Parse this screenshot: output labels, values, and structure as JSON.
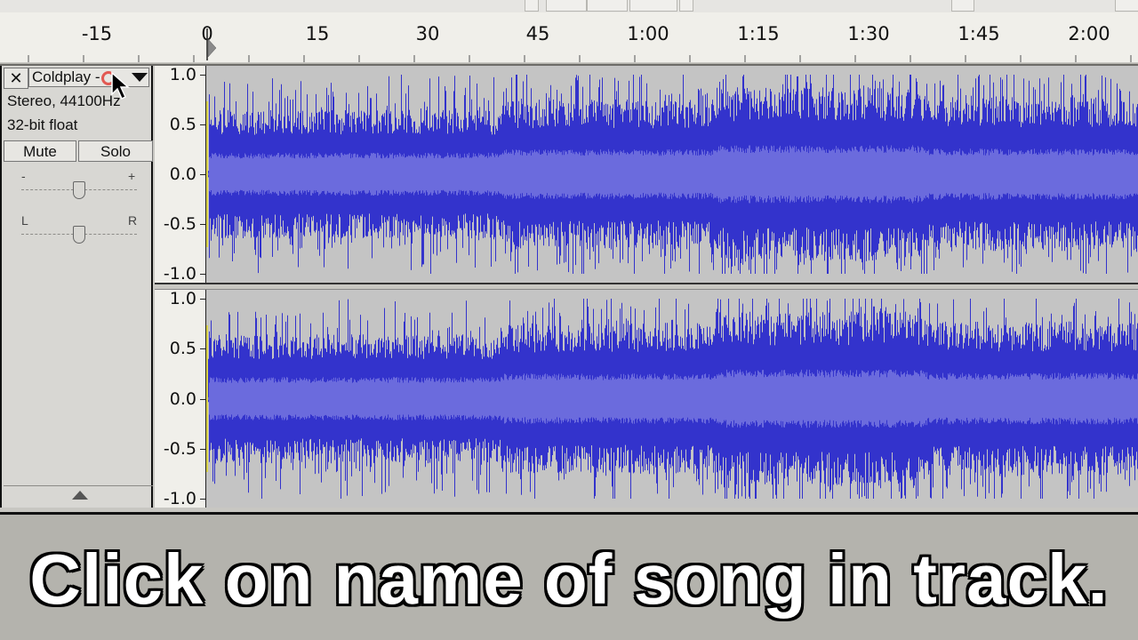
{
  "toolbar": {},
  "ruler": {
    "labels": [
      "-15",
      "0",
      "15",
      "30",
      "45",
      "1:00",
      "1:15",
      "1:30",
      "1:45",
      "2:00"
    ]
  },
  "track": {
    "name": "Coldplay -",
    "format": "Stereo, 44100Hz",
    "bit_depth": "32-bit float",
    "mute_label": "Mute",
    "solo_label": "Solo",
    "gain_minus": "-",
    "gain_plus": "+",
    "pan_left": "L",
    "pan_right": "R",
    "scale_labels": [
      "1.0",
      "0.5",
      "0.0",
      "-0.5",
      "-1.0"
    ]
  },
  "colors": {
    "waveform": "#3333cc",
    "waveform_rms": "#6b6bdd",
    "background": "#c4c4c4"
  },
  "icons": {
    "close": "close-icon",
    "dropdown": "chevron-down-icon",
    "collapse": "collapse-up-icon",
    "cursor": "mouse-pointer-icon"
  },
  "caption": "Click on name of song in track."
}
